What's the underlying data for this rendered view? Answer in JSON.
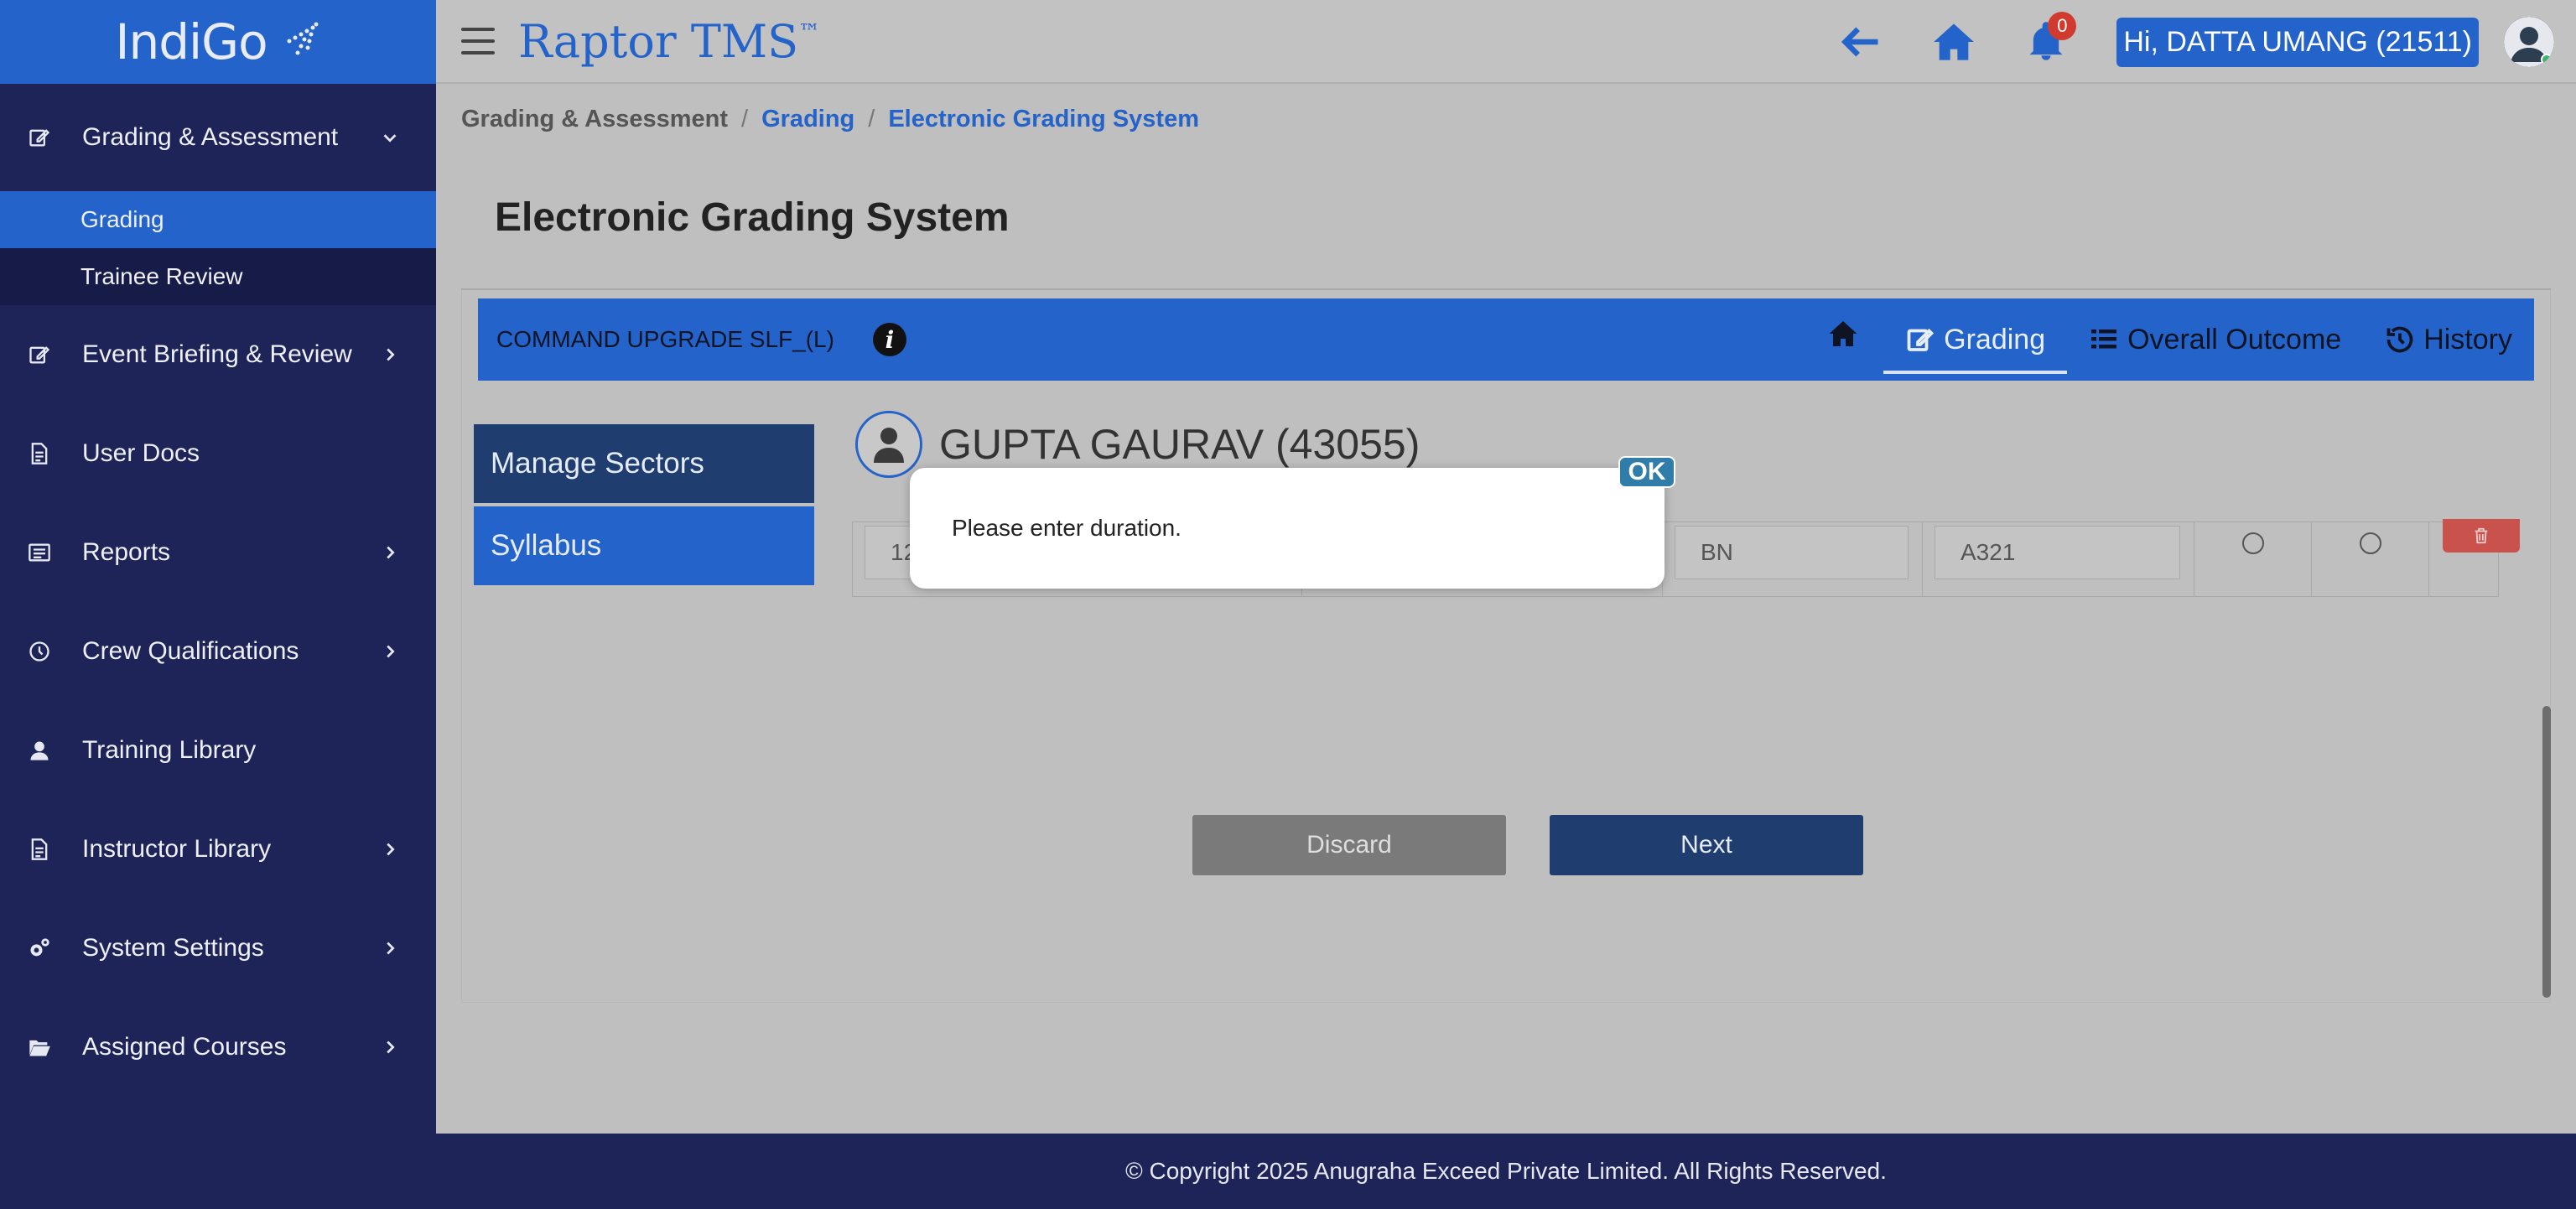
{
  "app": {
    "brand": "Raptor TMS",
    "brand_mark": "™",
    "logo_text": "IndiGo"
  },
  "header": {
    "notification_count": "0",
    "user_greeting": "Hi, DATTA UMANG (21511)"
  },
  "sidebar": {
    "items": [
      {
        "label": "Grading & Assessment",
        "icon": "edit-icon",
        "expanded": true,
        "children": [
          {
            "label": "Grading",
            "active": true
          },
          {
            "label": "Trainee Review"
          }
        ]
      },
      {
        "label": "Event Briefing & Review",
        "icon": "edit-icon"
      },
      {
        "label": "User Docs",
        "icon": "document-icon"
      },
      {
        "label": "Reports",
        "icon": "report-icon"
      },
      {
        "label": "Crew Qualifications",
        "icon": "clock-icon"
      },
      {
        "label": "Training Library",
        "icon": "user-icon"
      },
      {
        "label": "Instructor Library",
        "icon": "document-icon"
      },
      {
        "label": "System Settings",
        "icon": "gears-icon"
      },
      {
        "label": "Assigned Courses",
        "icon": "folder-open-icon"
      }
    ]
  },
  "breadcrumb": {
    "root": "Grading & Assessment",
    "sep": "/",
    "mid": "Grading",
    "current": "Electronic Grading System"
  },
  "page": {
    "title": "Electronic Grading System"
  },
  "course_bar": {
    "course_name": "COMMAND UPGRADE SLF_(L)",
    "info_glyph": "i",
    "tabs": [
      {
        "label": "Grading",
        "active": true
      },
      {
        "label": "Overall Outcome"
      },
      {
        "label": "History"
      }
    ]
  },
  "side_menu": {
    "manage_sectors": "Manage Sectors",
    "syllabus": "Syllabus"
  },
  "trainee": {
    "name": "GUPTA GAURAV (43055)"
  },
  "sector_row": {
    "date_partial": "12",
    "registration_partial": "BN",
    "aircraft_type": "A321"
  },
  "actions": {
    "discard": "Discard",
    "next": "Next"
  },
  "modal": {
    "message": "Please enter duration.",
    "ok": "OK"
  },
  "footer": {
    "copyright": "© Copyright 2025 Anugraha Exceed Private Limited.  All Rights Reserved."
  },
  "colors": {
    "primary_blue": "#2463c9",
    "navy": "#1e2358",
    "danger": "#c9524c"
  }
}
